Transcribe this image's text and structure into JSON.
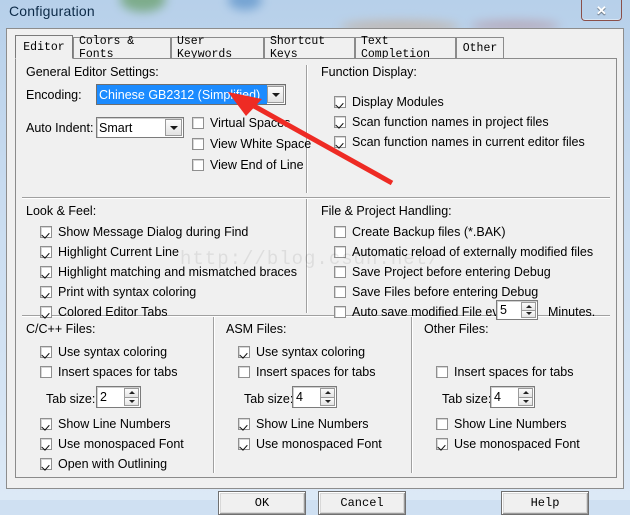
{
  "window": {
    "title": "Configuration",
    "close_label": "✕",
    "close_icon": "close-icon"
  },
  "tabs": [
    {
      "label": "Editor",
      "selected": true
    },
    {
      "label": "Colors & Fonts",
      "selected": false
    },
    {
      "label": "User Keywords",
      "selected": false
    },
    {
      "label": "Shortcut Keys",
      "selected": false
    },
    {
      "label": "Text Completion",
      "selected": false
    },
    {
      "label": "Other",
      "selected": false
    }
  ],
  "general": {
    "group_label": "General Editor Settings:",
    "encoding_label": "Encoding:",
    "encoding_value": "Chinese GB2312 (Simplified)",
    "auto_indent_label": "Auto Indent:",
    "auto_indent_value": "Smart",
    "checks": [
      {
        "label": "Virtual Spaces",
        "checked": false
      },
      {
        "label": "View White Space",
        "checked": false
      },
      {
        "label": "View End of Line",
        "checked": false
      }
    ]
  },
  "function_display": {
    "group_label": "Function Display:",
    "checks": [
      {
        "label": "Display Modules",
        "checked": true
      },
      {
        "label": "Scan function names in project files",
        "checked": true
      },
      {
        "label": "Scan function names in current editor files",
        "checked": true
      }
    ]
  },
  "look_feel": {
    "group_label": "Look & Feel:",
    "checks": [
      {
        "label": "Show Message Dialog during Find",
        "checked": true
      },
      {
        "label": "Highlight Current Line",
        "checked": true
      },
      {
        "label": "Highlight matching and mismatched braces",
        "checked": true
      },
      {
        "label": "Print with syntax coloring",
        "checked": true
      },
      {
        "label": "Colored Editor Tabs",
        "checked": true
      }
    ]
  },
  "file_project": {
    "group_label": "File & Project Handling:",
    "checks": [
      {
        "label": "Create Backup files (*.BAK)",
        "checked": false
      },
      {
        "label": "Automatic reload of externally modified files",
        "checked": false
      },
      {
        "label": "Save Project before entering Debug",
        "checked": false
      },
      {
        "label": "Save Files before entering Debug",
        "checked": false
      },
      {
        "label": "Auto save modified File every",
        "checked": false
      }
    ],
    "autosave_minutes": "5",
    "minutes_suffix": "Minutes."
  },
  "c_files": {
    "group_label": "C/C++ Files:",
    "syntax_label": "Use syntax coloring",
    "syntax_checked": true,
    "insert_spaces_label": "Insert spaces for tabs",
    "insert_spaces_checked": false,
    "tab_size_label": "Tab size:",
    "tab_size_value": "2",
    "line_numbers_label": "Show Line Numbers",
    "line_numbers_checked": true,
    "mono_label": "Use monospaced Font",
    "mono_checked": true,
    "outlining_label": "Open with Outlining",
    "outlining_checked": true
  },
  "asm_files": {
    "group_label": "ASM Files:",
    "syntax_label": "Use syntax coloring",
    "syntax_checked": true,
    "insert_spaces_label": "Insert spaces for tabs",
    "insert_spaces_checked": false,
    "tab_size_label": "Tab size:",
    "tab_size_value": "4",
    "line_numbers_label": "Show Line Numbers",
    "line_numbers_checked": true,
    "mono_label": "Use monospaced Font",
    "mono_checked": true
  },
  "other_files": {
    "group_label": "Other Files:",
    "insert_spaces_label": "Insert spaces for tabs",
    "insert_spaces_checked": false,
    "tab_size_label": "Tab size:",
    "tab_size_value": "4",
    "line_numbers_label": "Show Line Numbers",
    "line_numbers_checked": false,
    "mono_label": "Use monospaced Font",
    "mono_checked": true
  },
  "buttons": {
    "ok": "OK",
    "cancel": "Cancel",
    "help": "Help"
  },
  "watermark": "http://blog.csdn.net/",
  "colors": {
    "accent_selection": "#1b8bff",
    "dialog_face": "#f0f0f0",
    "annotation_arrow": "#ee2b24",
    "close_button": "#c8352c"
  }
}
